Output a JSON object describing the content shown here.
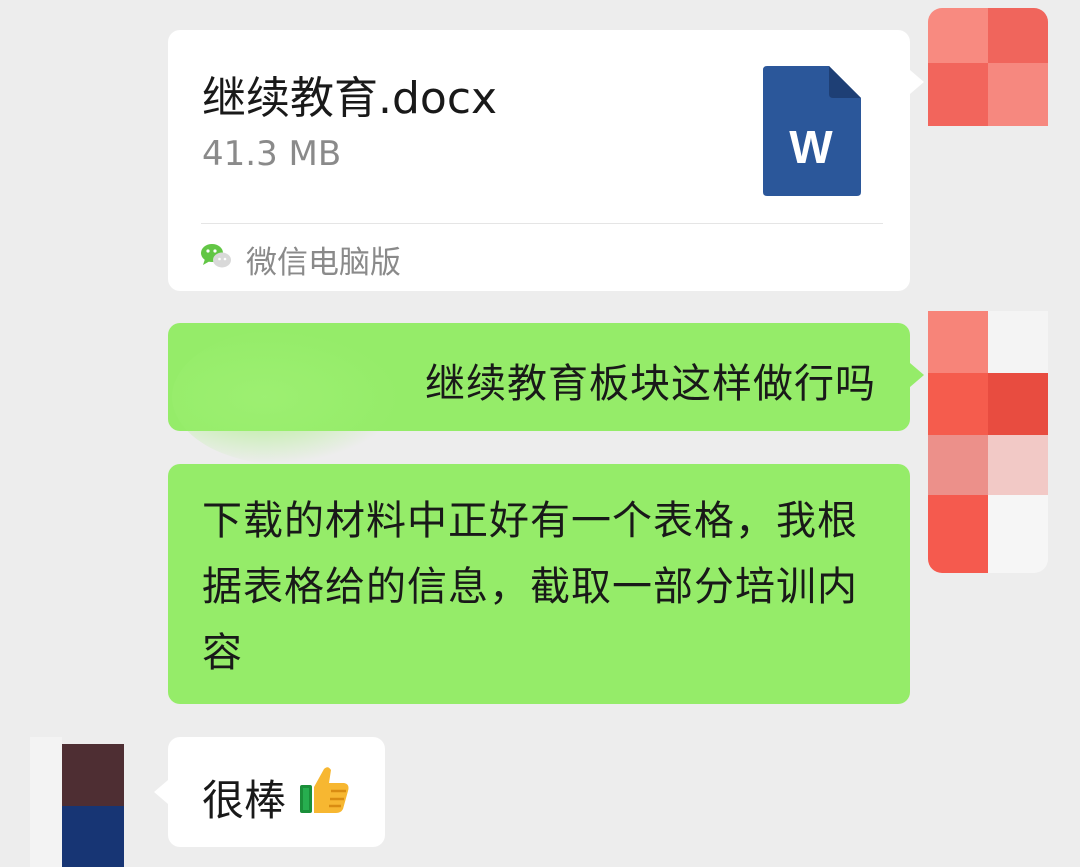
{
  "file_message": {
    "file_name": "继续教育.docx",
    "file_size": "41.3 MB",
    "file_icon": "word-doc-icon",
    "file_icon_letter": "W",
    "source_label": "微信电脑版",
    "source_icon": "wechat-icon"
  },
  "messages": [
    {
      "side": "sent",
      "text": "继续教育板块这样做行吗"
    },
    {
      "side": "sent",
      "text": "下载的材料中正好有一个表格，我根据表格给的信息，截取一部分培训内容"
    },
    {
      "side": "received",
      "text": "很棒",
      "emoji": "thumbs-up-icon"
    }
  ],
  "colors": {
    "background": "#ededed",
    "sent_bubble": "#95ec69",
    "received_bubble": "#ffffff",
    "word_blue": "#2b579a"
  }
}
